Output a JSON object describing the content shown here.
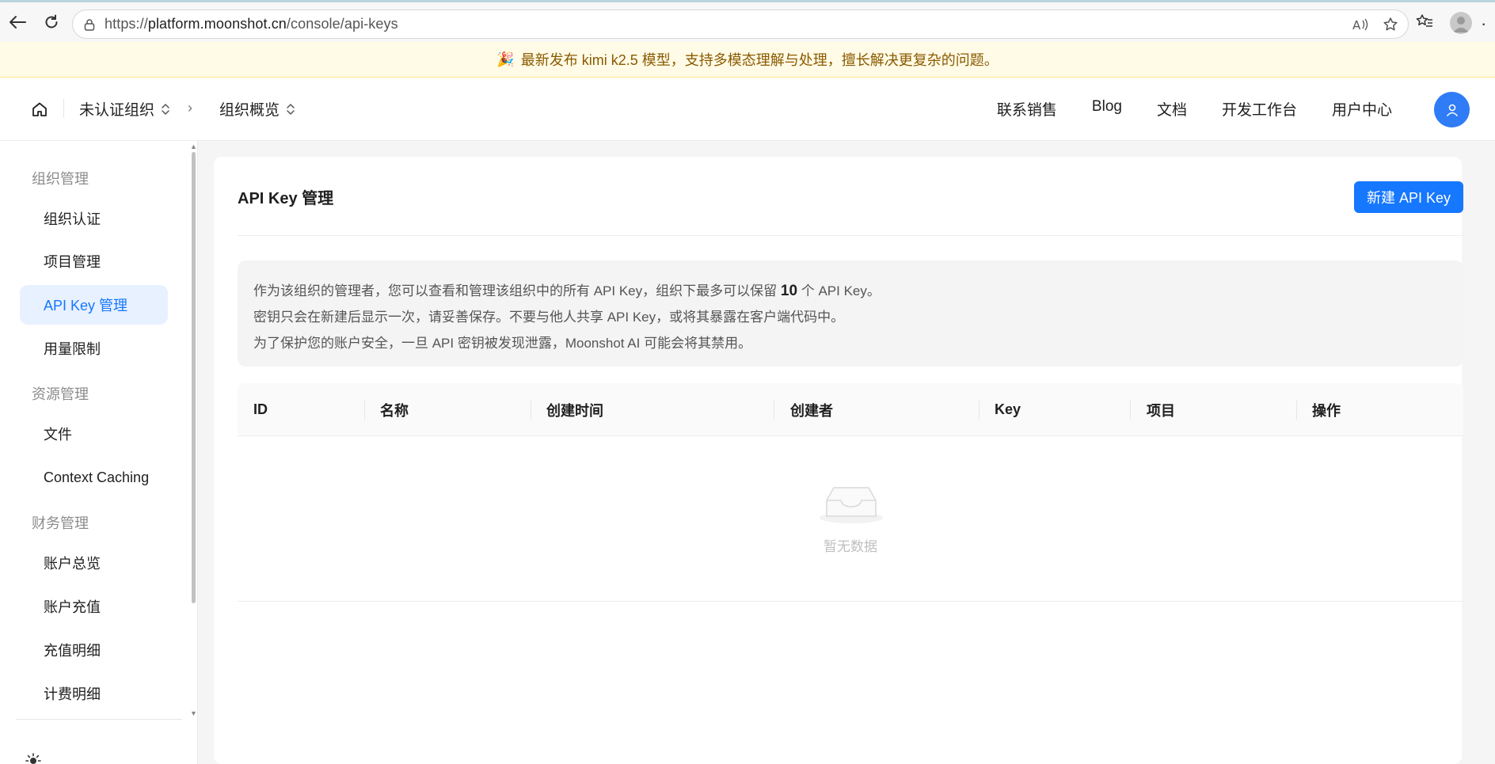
{
  "browser": {
    "url_scheme": "https://",
    "url_host": "platform.moonshot.cn",
    "url_path": "/console/api-keys"
  },
  "announcement": {
    "text": "最新发布 kimi k2.5 模型，支持多模态理解与处理，擅长解决更复杂的问题。"
  },
  "topnav": {
    "org": "未认证组织",
    "separator": "›",
    "overview": "组织概览",
    "links": [
      "联系销售",
      "Blog",
      "文档",
      "开发工作台",
      "用户中心"
    ]
  },
  "sidebar": {
    "groups": [
      {
        "title": "组织管理",
        "items": [
          "组织认证",
          "项目管理",
          "API Key 管理",
          "用量限制"
        ]
      },
      {
        "title": "资源管理",
        "items": [
          "文件",
          "Context Caching"
        ]
      },
      {
        "title": "财务管理",
        "items": [
          "账户总览",
          "账户充值",
          "充值明细",
          "计费明细"
        ]
      }
    ],
    "active_item": "API Key 管理"
  },
  "main": {
    "title": "API Key 管理",
    "create_button": "新建 API Key",
    "notice": {
      "line1_prefix": "作为该组织的管理者，您可以查看和管理该组织中的所有 API Key，组织下最多可以保留",
      "line1_count": "10",
      "line1_suffix": "个 API Key。",
      "line2": "密钥只会在新建后显示一次，请妥善保存。不要与他人共享 API Key，或将其暴露在客户端代码中。",
      "line3": "为了保护您的账户安全，一旦 API 密钥被发现泄露，Moonshot AI 可能会将其禁用。"
    },
    "table": {
      "columns": [
        "ID",
        "名称",
        "创建时间",
        "创建者",
        "Key",
        "项目",
        "操作"
      ],
      "empty_text": "暂无数据"
    }
  }
}
